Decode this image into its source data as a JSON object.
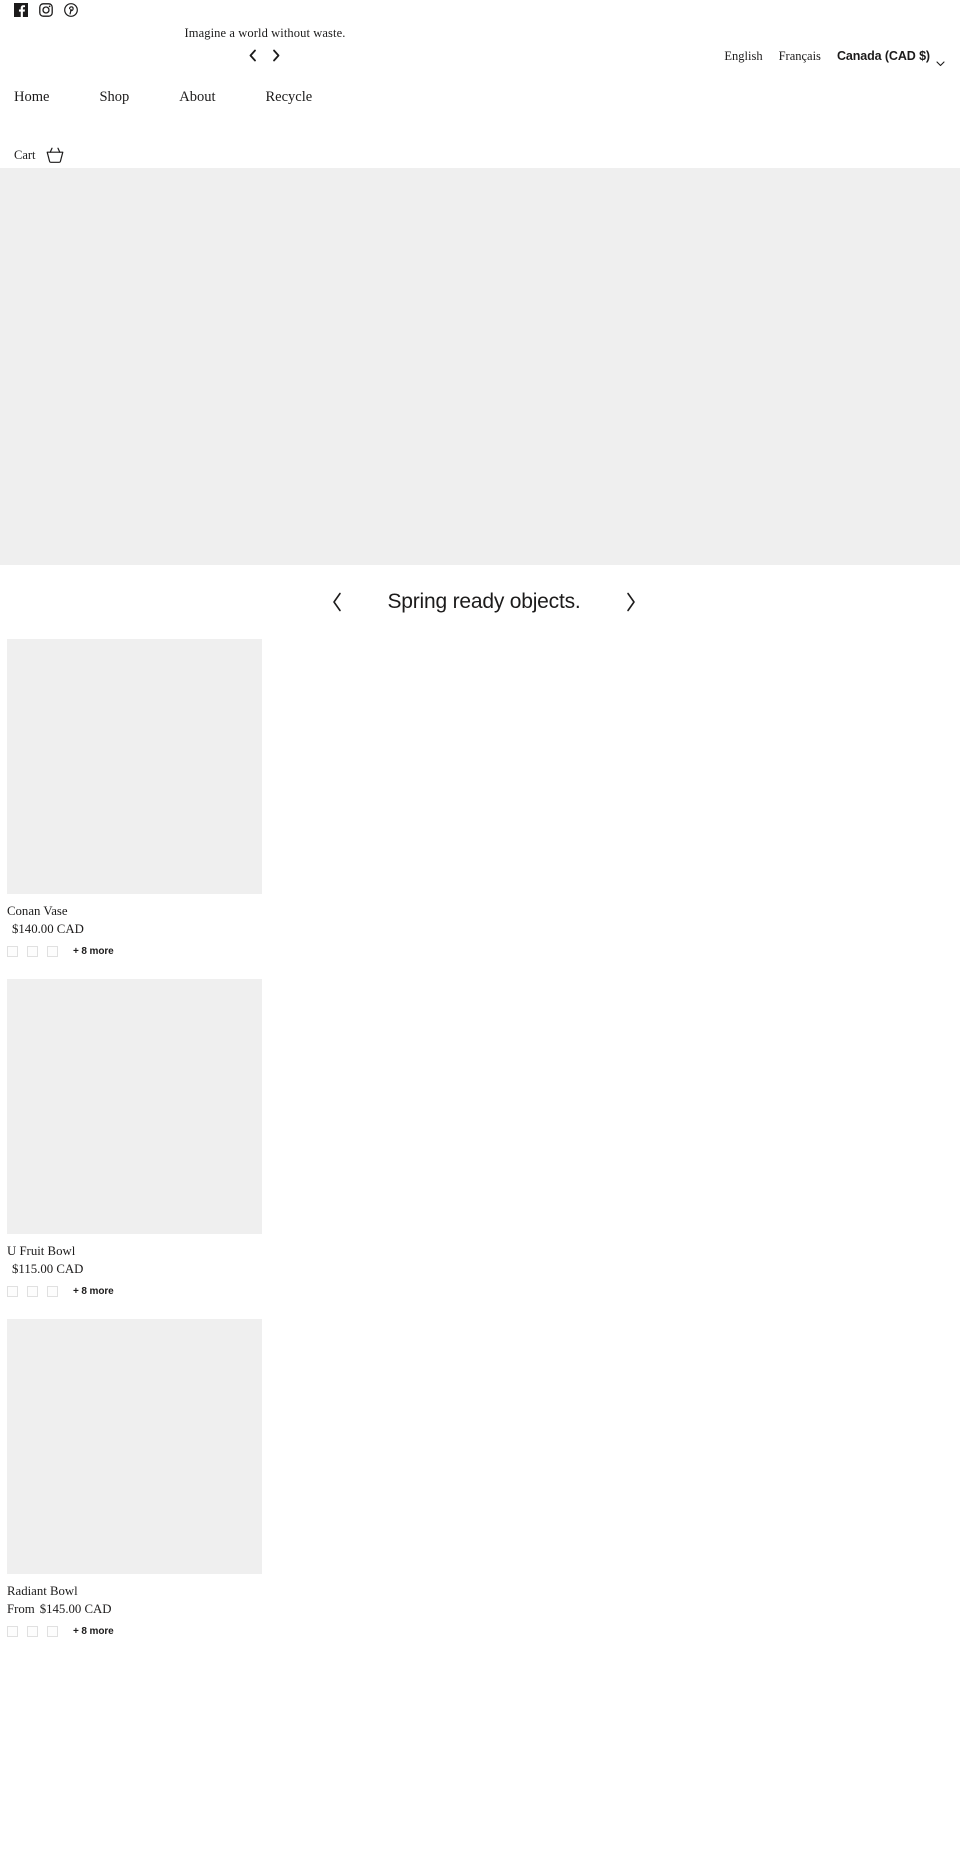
{
  "topbar": {
    "social": [
      {
        "name": "facebook-icon",
        "label": "Facebook"
      },
      {
        "name": "instagram-icon",
        "label": "Instagram"
      },
      {
        "name": "pinterest-icon",
        "label": "Pinterest"
      }
    ],
    "announcement": {
      "text": "Imagine a world without waste.",
      "prev_label": "Previous announcement",
      "next_label": "Next announcement"
    },
    "languages": [
      {
        "label": "English",
        "selected": true
      },
      {
        "label": "Français",
        "selected": false
      }
    ],
    "currency": {
      "label": "Canada (CAD $)",
      "options": [
        "Canada (CAD $)"
      ]
    }
  },
  "nav": {
    "links": [
      {
        "label": "Home"
      },
      {
        "label": "Shop"
      },
      {
        "label": "About"
      },
      {
        "label": "Recycle"
      }
    ],
    "cart": {
      "label": "Cart",
      "icon": "shopping-basket-icon"
    }
  },
  "hero": {
    "background_color": "#efefef"
  },
  "collection": {
    "title": "Spring ready objects.",
    "prev_label": "Previous",
    "next_label": "Next",
    "products": [
      {
        "title": "Conan Vase",
        "price_prefix": "",
        "price": "$140.00 CAD",
        "swatches": [
          "#fdfdfd",
          "#fdfdfd",
          "#fdfdfd"
        ],
        "more_label": "+ 8 more"
      },
      {
        "title": "U Fruit Bowl",
        "price_prefix": "",
        "price": "$115.00 CAD",
        "swatches": [
          "#fdfdfd",
          "#fdfdfd",
          "#fdfdfd"
        ],
        "more_label": "+ 8 more"
      },
      {
        "title": "Radiant Bowl",
        "price_prefix": "From",
        "price": "$145.00 CAD",
        "swatches": [
          "#fdfdfd",
          "#fdfdfd",
          "#fdfdfd"
        ],
        "more_label": "+ 8 more"
      }
    ]
  },
  "colors": {
    "text": "#1c1b1b",
    "placeholder": "#efefef",
    "swatch_border": "#e0e0e0"
  }
}
